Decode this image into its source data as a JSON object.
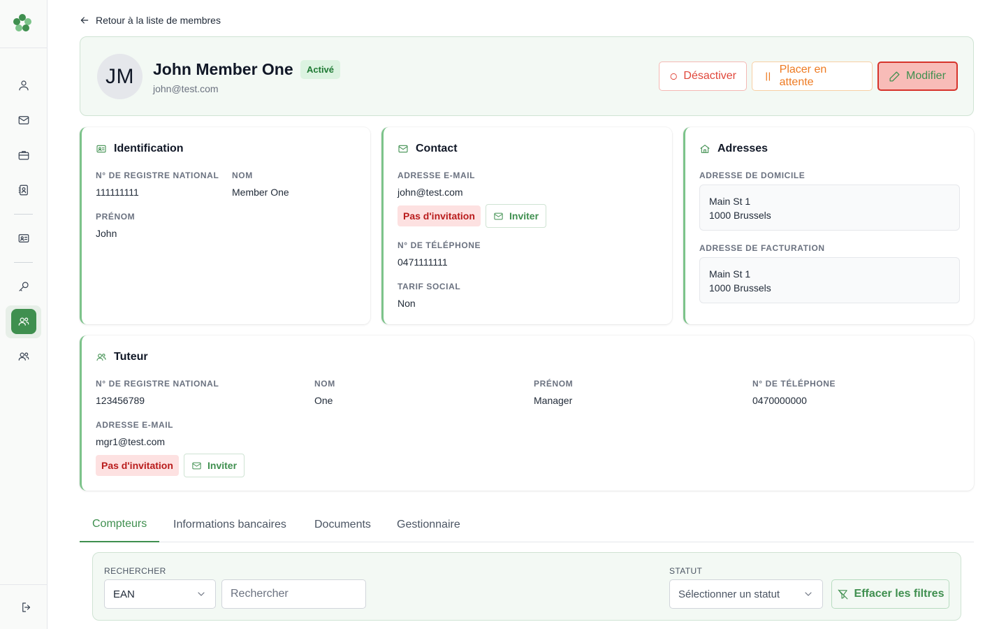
{
  "nav": {
    "back_label": "Retour à la liste de membres",
    "items": [
      "user-icon",
      "mail-icon",
      "briefcase-icon",
      "contact-book-icon",
      "id-card-icon",
      "key-icon",
      "members-icon",
      "managers-icon",
      "logout-icon"
    ],
    "active_item": "members-icon"
  },
  "member": {
    "initials": "JM",
    "name": "John Member One",
    "status": "Activé",
    "email": "john@test.com"
  },
  "actions": {
    "deactivate": "Désactiver",
    "hold": "Placer en attente",
    "edit": "Modifier"
  },
  "identification": {
    "title": "Identification",
    "national_register_label": "N° de registre national",
    "national_register": "111111111",
    "last_name_label": "Nom",
    "last_name": "Member One",
    "first_name_label": "Prénom",
    "first_name": "John"
  },
  "contact": {
    "title": "Contact",
    "email_label": "Adresse e-mail",
    "email": "john@test.com",
    "invitation_status": "Pas d'invitation",
    "invite_label": "Inviter",
    "phone_label": "N° de téléphone",
    "phone": "0471111111",
    "social_tariff_label": "Tarif social",
    "social_tariff": "Non"
  },
  "addresses": {
    "title": "Adresses",
    "home_label": "Adresse de domicile",
    "home_line1": "Main St 1",
    "home_line2": "1000 Brussels",
    "billing_label": "Adresse de facturation",
    "billing_line1": "Main St 1",
    "billing_line2": "1000 Brussels"
  },
  "guardian": {
    "title": "Tuteur",
    "national_register_label": "N° de registre national",
    "national_register": "123456789",
    "last_name_label": "Nom",
    "last_name": "One",
    "first_name_label": "Prénom",
    "first_name": "Manager",
    "phone_label": "N° de téléphone",
    "phone": "0470000000",
    "email_label": "Adresse e-mail",
    "email": "mgr1@test.com",
    "invitation_status": "Pas d'invitation",
    "invite_label": "Inviter"
  },
  "tabs": [
    {
      "label": "Compteurs",
      "active": true
    },
    {
      "label": "Informations bancaires",
      "active": false
    },
    {
      "label": "Documents",
      "active": false
    },
    {
      "label": "Gestionnaire",
      "active": false
    }
  ],
  "filters": {
    "search_label": "RECHERCHER",
    "search_field_selected": "EAN",
    "search_placeholder": "Rechercher",
    "status_label": "STATUT",
    "status_placeholder": "Sélectionner un statut",
    "clear_label": "Effacer les filtres"
  },
  "colors": {
    "brand_green": "#3f8f4f",
    "danger_red": "#e0463a",
    "warning_orange": "#ee7a21",
    "active_badge_bg": "#dcf3e1"
  }
}
